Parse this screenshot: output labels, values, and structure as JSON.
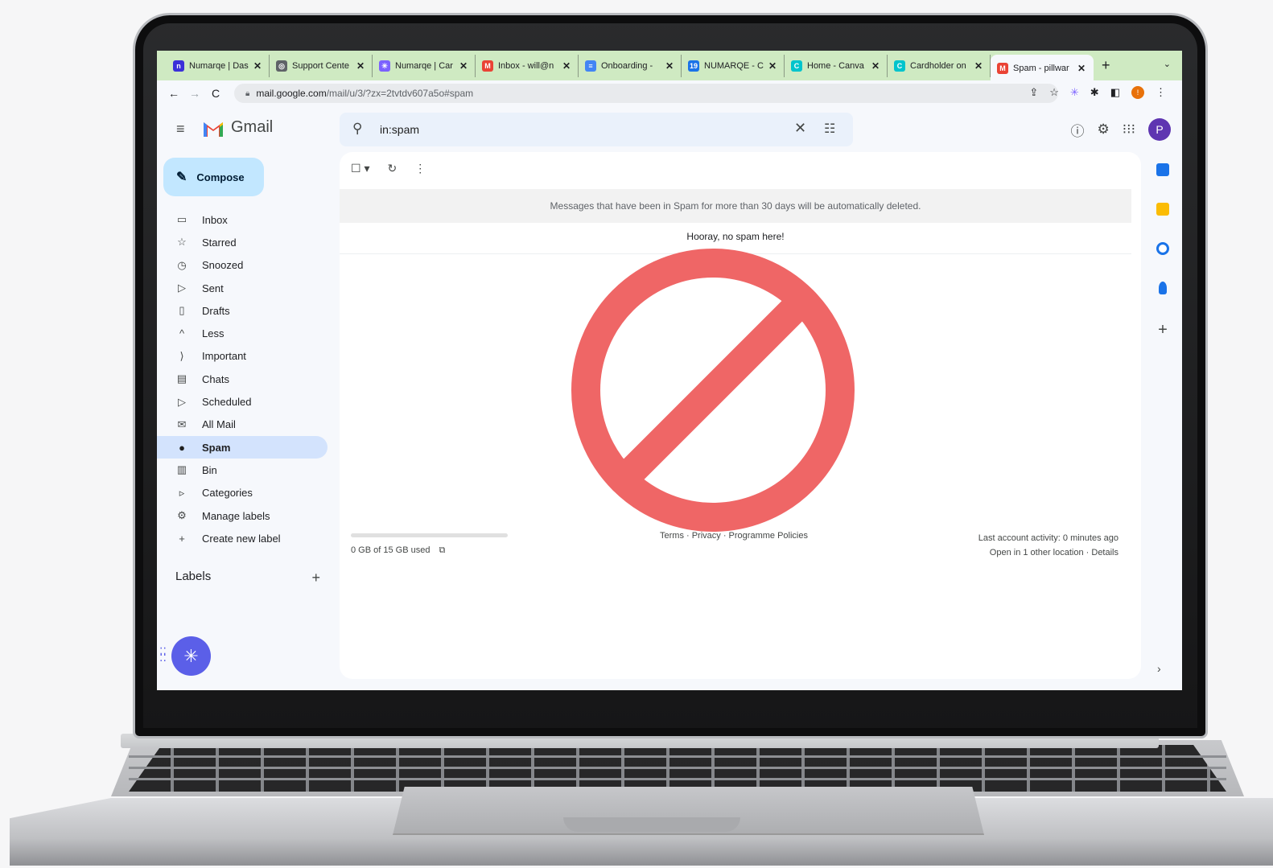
{
  "browser": {
    "tabs": [
      {
        "title": "Numarqe | Das",
        "color": "#3b30d9",
        "glyph": "n"
      },
      {
        "title": "Support Cente",
        "color": "#5f6368",
        "glyph": "◎"
      },
      {
        "title": "Numarqe | Car",
        "color": "#7b61ff",
        "glyph": "✳"
      },
      {
        "title": "Inbox - will@n",
        "color": "#ea4335",
        "glyph": "M"
      },
      {
        "title": "Onboarding - ",
        "color": "#4285f4",
        "glyph": "≡"
      },
      {
        "title": "NUMARQE - C",
        "color": "#1a73e8",
        "glyph": "19"
      },
      {
        "title": "Home - Canva",
        "color": "#00c4cc",
        "glyph": "C"
      },
      {
        "title": "Cardholder on",
        "color": "#00c4cc",
        "glyph": "C"
      },
      {
        "title": "Spam - pillwar",
        "color": "#ea4335",
        "glyph": "M",
        "active": true
      }
    ],
    "url_host": "mail.google.com",
    "url_path": "/mail/u/3/?zx=2tvtdv607a5o#spam",
    "profile_initial": "!"
  },
  "gmail": {
    "brand": "Gmail",
    "search_query": "in:spam",
    "profile_initial": "P",
    "compose_label": "Compose",
    "nav": [
      {
        "label": "Inbox",
        "icon": "inbox-icon",
        "glyph": "▭"
      },
      {
        "label": "Starred",
        "icon": "star-icon",
        "glyph": "☆"
      },
      {
        "label": "Snoozed",
        "icon": "clock-icon",
        "glyph": "◷"
      },
      {
        "label": "Sent",
        "icon": "send-icon",
        "glyph": "▷"
      },
      {
        "label": "Drafts",
        "icon": "draft-icon",
        "glyph": "▯"
      },
      {
        "label": "Less",
        "icon": "chevron-up-icon",
        "glyph": "^"
      },
      {
        "label": "Important",
        "icon": "important-icon",
        "glyph": "⟩"
      },
      {
        "label": "Chats",
        "icon": "chat-icon",
        "glyph": "▤"
      },
      {
        "label": "Scheduled",
        "icon": "scheduled-icon",
        "glyph": "▷"
      },
      {
        "label": "All Mail",
        "icon": "all-mail-icon",
        "glyph": "✉"
      },
      {
        "label": "Spam",
        "icon": "spam-icon",
        "glyph": "●",
        "active": true
      },
      {
        "label": "Bin",
        "icon": "bin-icon",
        "glyph": "▥"
      },
      {
        "label": "Categories",
        "icon": "label-icon",
        "glyph": "▹"
      },
      {
        "label": "Manage labels",
        "icon": "gear-icon",
        "glyph": "⚙"
      },
      {
        "label": "Create new label",
        "icon": "plus-icon",
        "glyph": "+"
      }
    ],
    "labels_heading": "Labels",
    "spam_banner": "Messages that have been in Spam for more than 30 days will be automatically deleted.",
    "empty_message": "Hooray, no spam here!",
    "storage_text": "0 GB of 15 GB used",
    "footer_links": "Terms · Privacy · Programme Policies",
    "last_activity": "Last account activity: 0 minutes ago",
    "other_location": "Open in 1 other location · Details"
  },
  "colors": {
    "tabbar_bg": "#cfeac2",
    "compose_bg": "#c2e7ff",
    "active_nav_bg": "#d3e3fd",
    "no_sign": "#ef6666"
  }
}
